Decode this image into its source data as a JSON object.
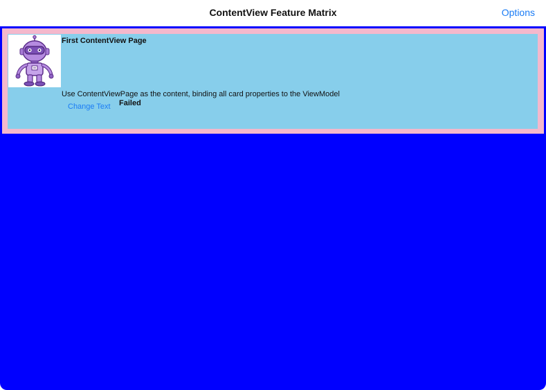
{
  "navbar": {
    "title": "ContentView Feature Matrix",
    "options_label": "Options"
  },
  "card": {
    "image_icon": "robot-mascot-icon",
    "title": "First ContentView Page",
    "description": "Use ContentViewPage as the content, binding all card properties to the ViewModel",
    "button_label": "Change Text",
    "status": "Failed"
  },
  "colors": {
    "content_background": "#0000ff",
    "card_border": "#f4b8cc",
    "card_background": "#87ceeb",
    "accent": "#1a7cf5"
  }
}
